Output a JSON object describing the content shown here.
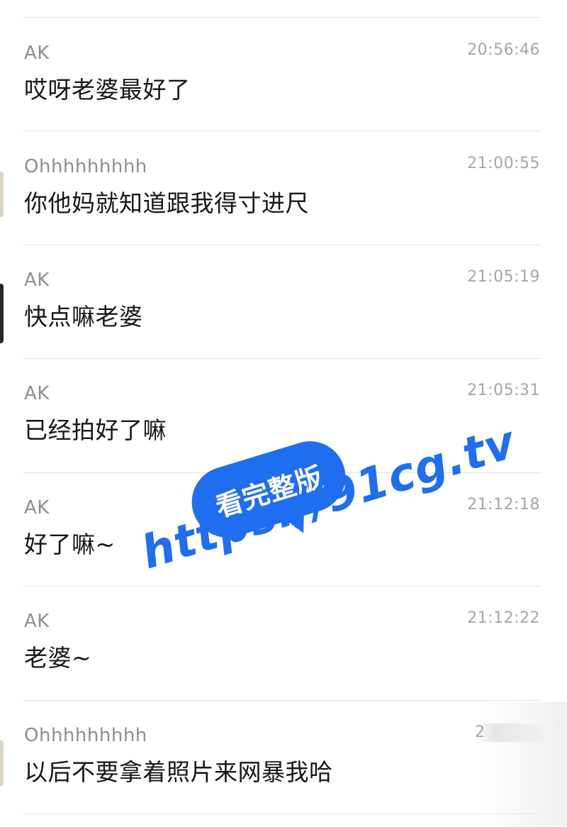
{
  "messages": [
    {
      "sender": "AK",
      "time": "20:56:46",
      "text": "哎呀老婆最好了"
    },
    {
      "sender": "Ohhhhhhhhh",
      "time": "21:00:55",
      "text": "你他妈就知道跟我得寸进尺"
    },
    {
      "sender": "AK",
      "time": "21:05:19",
      "text": "快点嘛老婆"
    },
    {
      "sender": "AK",
      "time": "21:05:31",
      "text": "已经拍好了嘛"
    },
    {
      "sender": "AK",
      "time": "21:12:18",
      "text": "好了嘛~"
    },
    {
      "sender": "AK",
      "time": "21:12:22",
      "text": "老婆~"
    },
    {
      "sender": "Ohhhhhhhhh",
      "time_visible": "2",
      "text": "以后不要拿着照片来网暴我哈"
    }
  ],
  "watermark": {
    "bubble_text": "看完整版",
    "url": "https://91cg.tv",
    "color": "#1f6ef0"
  }
}
